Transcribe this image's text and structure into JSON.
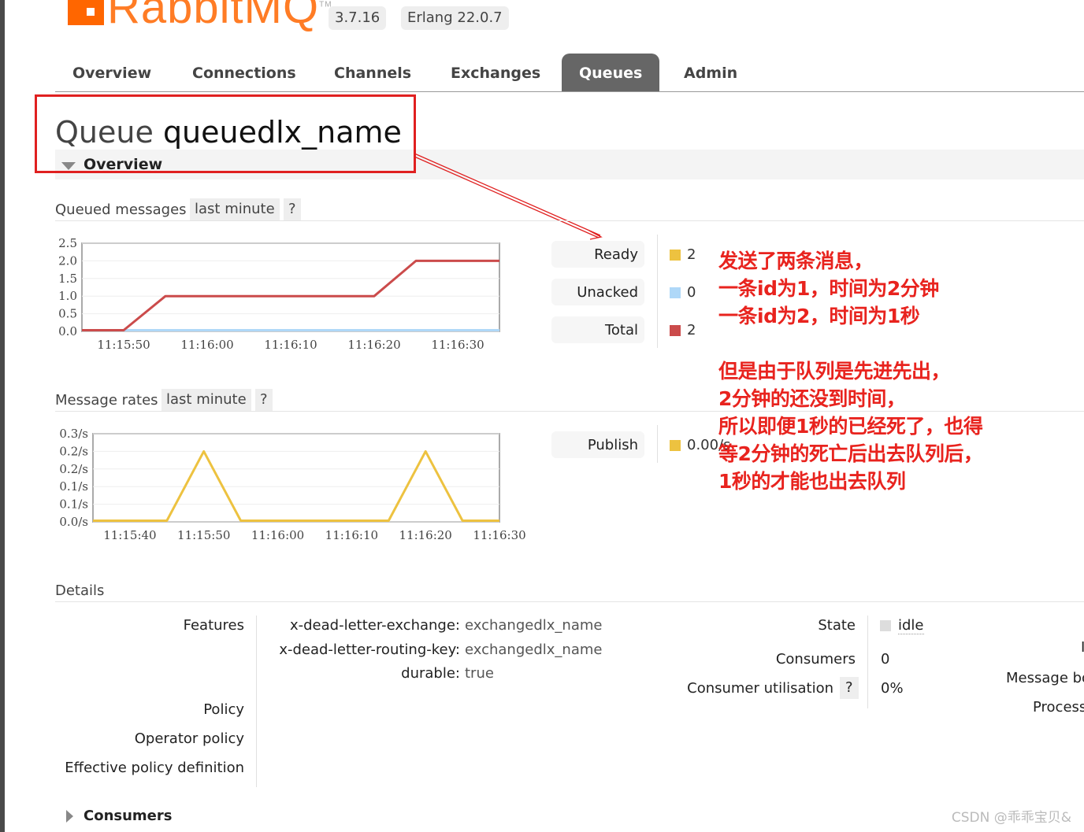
{
  "header": {
    "logo_text": "RabbitMQ",
    "version": "3.7.16",
    "erlang": "Erlang 22.0.7",
    "colors": {
      "brand": "#ff6600"
    }
  },
  "tabs": [
    {
      "label": "Overview",
      "active": false
    },
    {
      "label": "Connections",
      "active": false
    },
    {
      "label": "Channels",
      "active": false
    },
    {
      "label": "Exchanges",
      "active": false
    },
    {
      "label": "Queues",
      "active": true
    },
    {
      "label": "Admin",
      "active": false
    }
  ],
  "page": {
    "title_prefix": "Queue",
    "queue_name": "queuedlx_name",
    "section_overview": "Overview"
  },
  "queued_messages": {
    "heading": "Queued messages",
    "range": "last minute",
    "help": "?",
    "legend": [
      {
        "label": "Ready",
        "value": "2",
        "color": "#edc240"
      },
      {
        "label": "Unacked",
        "value": "0",
        "color": "#afd8f8"
      },
      {
        "label": "Total",
        "value": "2",
        "color": "#cb4b4b"
      }
    ]
  },
  "message_rates": {
    "heading": "Message rates",
    "range": "last minute",
    "help": "?",
    "legend": [
      {
        "label": "Publish",
        "value": "0.00/s",
        "color": "#edc240"
      }
    ]
  },
  "chart_data": [
    {
      "type": "line",
      "title": "Queued messages",
      "x_ticks": [
        "11:15:50",
        "11:16:00",
        "11:16:10",
        "11:16:20",
        "11:16:30"
      ],
      "y_ticks": [
        "0.0",
        "0.5",
        "1.0",
        "1.5",
        "2.0",
        "2.5"
      ],
      "ylim": [
        0,
        2.5
      ],
      "x": [
        "11:15:45",
        "11:15:50",
        "11:15:55",
        "11:16:20",
        "11:16:25",
        "11:16:35"
      ],
      "series": [
        {
          "name": "Total",
          "color": "#cb4b4b",
          "values": [
            0,
            0,
            1,
            1,
            2,
            2
          ]
        },
        {
          "name": "Unacked",
          "color": "#afd8f8",
          "values": [
            0,
            0,
            0,
            0,
            0,
            0
          ]
        }
      ]
    },
    {
      "type": "line",
      "title": "Message rates",
      "x_ticks": [
        "11:15:40",
        "11:15:50",
        "11:16:00",
        "11:16:10",
        "11:16:20",
        "11:16:30"
      ],
      "y_ticks": [
        "0.0/s",
        "0.1/s",
        "0.1/s",
        "0.2/s",
        "0.2/s",
        "0.3/s"
      ],
      "ylim": [
        0,
        0.25
      ],
      "x": [
        "11:15:35",
        "11:15:45",
        "11:15:50",
        "11:15:55",
        "11:16:15",
        "11:16:20",
        "11:16:25",
        "11:16:30"
      ],
      "series": [
        {
          "name": "Publish",
          "color": "#edc240",
          "values": [
            0,
            0,
            0.2,
            0,
            0,
            0.2,
            0,
            0
          ]
        }
      ]
    }
  ],
  "annotation": {
    "lines": [
      "发送了两条消息，",
      "一条id为1，时间为2分钟",
      "一条id为2，时间为1秒",
      "",
      "但是由于队列是先进先出，",
      "2分钟的还没到时间，",
      "所以即便1秒的已经死了，也得",
      "等2分钟的死亡后出去队列后，",
      "1秒的才能也出去队列"
    ],
    "color": "#e8231e"
  },
  "details": {
    "heading": "Details",
    "features_label": "Features",
    "features": [
      {
        "key": "x-dead-letter-exchange:",
        "value": "exchangedlx_name"
      },
      {
        "key": "x-dead-letter-routing-key:",
        "value": "exchangedlx_name"
      },
      {
        "key": "durable:",
        "value": "true"
      }
    ],
    "policy_label": "Policy",
    "operator_policy_label": "Operator policy",
    "effective_policy_label": "Effective policy definition",
    "state_label": "State",
    "state_value": "idle",
    "consumers_label": "Consumers",
    "consumers_value": "0",
    "consumer_util_label": "Consumer utilisation",
    "consumer_util_help": "?",
    "consumer_util_value": "0%",
    "cut_label_1": "I",
    "message_body_label": "Message bo",
    "process_label": "Process"
  },
  "consumers_section": "Consumers",
  "watermark": "CSDN @乖乖宝贝&"
}
